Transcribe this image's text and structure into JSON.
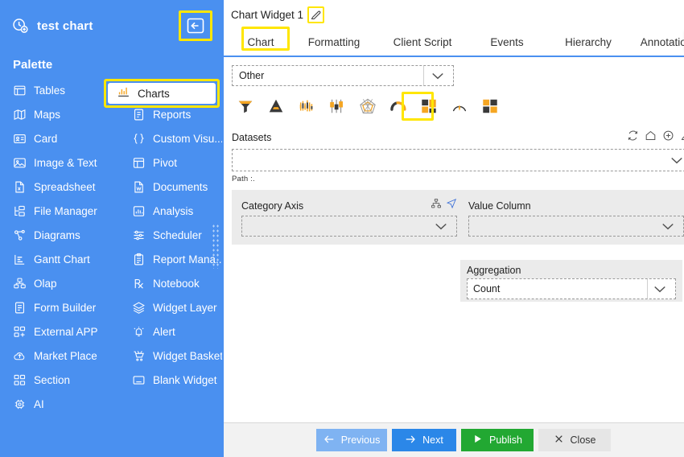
{
  "sidebar": {
    "title": "test chart",
    "logo_icon": "clock-add-icon",
    "collapse_icon": "collapse-left-icon",
    "palette_label": "Palette",
    "active_item": "Charts",
    "items": [
      {
        "label": "Tables",
        "icon": "table-icon"
      },
      {
        "label": "Charts",
        "icon": "bar-chart-icon"
      },
      {
        "label": "Maps",
        "icon": "map-icon"
      },
      {
        "label": "Reports",
        "icon": "report-icon"
      },
      {
        "label": "Card",
        "icon": "card-icon"
      },
      {
        "label": "Custom Visu...",
        "icon": "braces-icon"
      },
      {
        "label": "Image & Text",
        "icon": "image-text-icon"
      },
      {
        "label": "Pivot",
        "icon": "pivot-icon"
      },
      {
        "label": "Spreadsheet",
        "icon": "spreadsheet-icon"
      },
      {
        "label": "Documents",
        "icon": "document-icon"
      },
      {
        "label": "File Manager",
        "icon": "file-manager-icon"
      },
      {
        "label": "Analysis",
        "icon": "analysis-icon"
      },
      {
        "label": "Diagrams",
        "icon": "diagram-icon"
      },
      {
        "label": "Scheduler",
        "icon": "scheduler-icon"
      },
      {
        "label": "Gantt Chart",
        "icon": "gantt-icon"
      },
      {
        "label": "Report Mana...",
        "icon": "clipboard-icon"
      },
      {
        "label": "Olap",
        "icon": "olap-cube-icon"
      },
      {
        "label": "Notebook",
        "icon": "prescription-icon"
      },
      {
        "label": "Form Builder",
        "icon": "form-icon"
      },
      {
        "label": "Widget Layer",
        "icon": "layers-icon"
      },
      {
        "label": "External APP",
        "icon": "external-app-icon"
      },
      {
        "label": "Alert",
        "icon": "alert-bell-icon"
      },
      {
        "label": "Market Place",
        "icon": "cloud-upload-icon"
      },
      {
        "label": "Widget Basket",
        "icon": "basket-icon"
      },
      {
        "label": "Section",
        "icon": "section-grid-icon"
      },
      {
        "label": "Blank Widget",
        "icon": "blank-widget-icon"
      },
      {
        "label": "AI",
        "icon": "ai-chip-icon"
      }
    ]
  },
  "panel": {
    "widget_title": "Chart Widget 1",
    "edit_icon": "edit-pencil-icon",
    "scroll_right_icon": "chevron-right-icon",
    "tabs": [
      {
        "label": "Chart",
        "active": true
      },
      {
        "label": "Formatting",
        "active": false
      },
      {
        "label": "Client Script",
        "active": false
      },
      {
        "label": "Events",
        "active": false
      },
      {
        "label": "Hierarchy",
        "active": false
      },
      {
        "label": "Annotation",
        "active": false
      }
    ],
    "chart_category": {
      "value": "Other",
      "placeholder": "",
      "chevron_icon": "chevron-down-icon"
    },
    "chart_types": [
      {
        "name": "funnel-chart-icon",
        "selected": false
      },
      {
        "name": "pyramid-chart-icon",
        "selected": false
      },
      {
        "name": "candlestick-chart-icon",
        "selected": false
      },
      {
        "name": "boxplot-chart-icon",
        "selected": false
      },
      {
        "name": "radar-chart-icon",
        "selected": false
      },
      {
        "name": "arc-gauge-chart-icon",
        "selected": false
      },
      {
        "name": "treemap-chart-icon",
        "selected": true
      },
      {
        "name": "gauge-chart-icon",
        "selected": false
      },
      {
        "name": "tile-map-chart-icon",
        "selected": false
      }
    ],
    "datasets": {
      "label": "Datasets",
      "value": "",
      "chevron_icon": "chevron-down-icon",
      "path_text": "Path :.",
      "actions": [
        {
          "name": "refresh-icon"
        },
        {
          "name": "home-icon"
        },
        {
          "name": "add-circle-icon"
        },
        {
          "name": "edit-pencil-icon"
        }
      ]
    },
    "category_axis": {
      "label": "Category Axis",
      "value": "",
      "chevron_icon": "chevron-down-icon",
      "icons": [
        {
          "name": "hierarchy-icon"
        },
        {
          "name": "cursor-arrow-icon"
        }
      ]
    },
    "value_column": {
      "label": "Value Column",
      "value": "",
      "chevron_icon": "chevron-down-icon"
    },
    "aggregation": {
      "label": "Aggregation",
      "value": "Count",
      "chevron_icon": "chevron-down-icon"
    }
  },
  "footer": {
    "buttons": [
      {
        "label": "Previous",
        "icon": "arrow-left-icon",
        "style": "prev"
      },
      {
        "label": "Next",
        "icon": "arrow-right-icon",
        "style": "next"
      },
      {
        "label": "Publish",
        "icon": "play-icon",
        "style": "publish"
      },
      {
        "label": "Close",
        "icon": "close-x-icon",
        "style": "close"
      }
    ]
  },
  "colors": {
    "sidebar_blue": "#4a90f0",
    "highlight_yellow": "#ffe600",
    "accent_orange": "#f5a623",
    "publish_green": "#22a832",
    "next_blue": "#2b87e8",
    "prev_blue": "#7fb3f2"
  }
}
